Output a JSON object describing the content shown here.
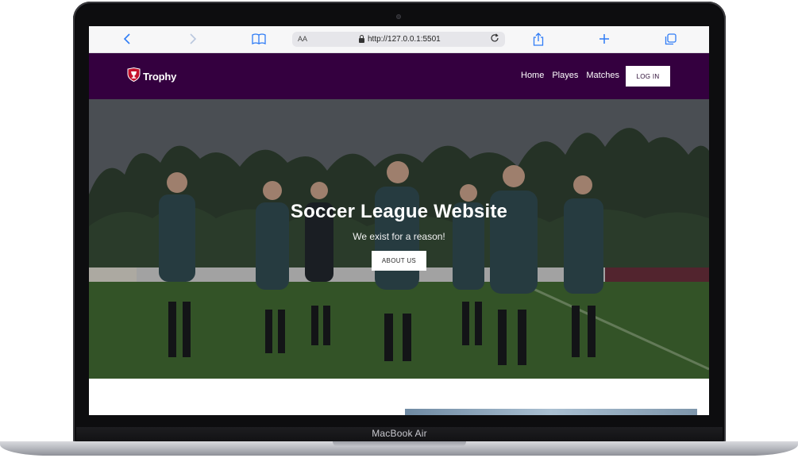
{
  "device": {
    "label": "MacBook Air"
  },
  "browser": {
    "text_size_label": "AA",
    "url": "http://127.0.0.1:5501",
    "icons": {
      "back": "chevron-left-icon",
      "forward": "chevron-right-icon",
      "bookmarks": "book-icon",
      "lock": "lock-icon",
      "reload": "reload-icon",
      "share": "share-icon",
      "new_tab": "plus-icon",
      "tabs": "tabs-icon"
    },
    "accent": "#2f7cf6"
  },
  "site": {
    "brand": "Trophy",
    "nav_color": "#34003f",
    "nav": [
      "Home",
      "Playes",
      "Matches"
    ],
    "login_label": "LOG IN",
    "hero": {
      "title": "Soccer League Website",
      "subtitle": "We exist for a reason!",
      "button_label": "ABOUT US",
      "image": "soccer-players-walking-on-pitch"
    }
  }
}
